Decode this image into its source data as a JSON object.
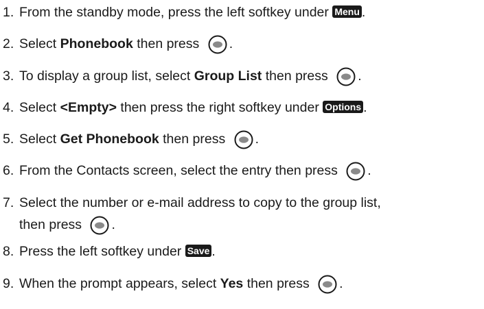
{
  "steps": [
    {
      "num": "1.",
      "parts": [
        {
          "t": "text",
          "v": "From the standby mode, press the left softkey under "
        },
        {
          "t": "softkey",
          "v": "Menu",
          "name": "menu-softkey-label"
        },
        {
          "t": "text",
          "v": "."
        }
      ]
    },
    {
      "num": "2.",
      "parts": [
        {
          "t": "text",
          "v": "Select "
        },
        {
          "t": "bold",
          "v": "Phonebook"
        },
        {
          "t": "text",
          "v": " then press "
        },
        {
          "t": "icon"
        },
        {
          "t": "text",
          "v": "."
        }
      ]
    },
    {
      "num": "3.",
      "parts": [
        {
          "t": "text",
          "v": "To display a group list, select "
        },
        {
          "t": "bold",
          "v": "Group List"
        },
        {
          "t": "text",
          "v": " then press "
        },
        {
          "t": "icon"
        },
        {
          "t": "text",
          "v": "."
        }
      ]
    },
    {
      "num": "4.",
      "parts": [
        {
          "t": "text",
          "v": "Select "
        },
        {
          "t": "bold",
          "v": "<Empty>"
        },
        {
          "t": "text",
          "v": " then press the right softkey under "
        },
        {
          "t": "softkey",
          "v": "Options",
          "name": "options-softkey-label"
        },
        {
          "t": "text",
          "v": "."
        }
      ]
    },
    {
      "num": "5.",
      "parts": [
        {
          "t": "text",
          "v": "Select "
        },
        {
          "t": "bold",
          "v": "Get Phonebook"
        },
        {
          "t": "text",
          "v": " then press "
        },
        {
          "t": "icon"
        },
        {
          "t": "text",
          "v": "."
        }
      ]
    },
    {
      "num": "6.",
      "parts": [
        {
          "t": "text",
          "v": "From the Contacts screen, select the entry then press "
        },
        {
          "t": "icon"
        },
        {
          "t": "text",
          "v": "."
        }
      ]
    },
    {
      "num": "7.",
      "parts": [
        {
          "t": "text",
          "v": "Select the number or e-mail address to copy to the group list,"
        }
      ],
      "cont": [
        {
          "t": "text",
          "v": "then press "
        },
        {
          "t": "icon"
        },
        {
          "t": "text",
          "v": "."
        }
      ]
    },
    {
      "num": "8.",
      "parts": [
        {
          "t": "text",
          "v": "Press the left softkey under "
        },
        {
          "t": "softkey",
          "v": "Save",
          "name": "save-softkey-label"
        },
        {
          "t": "text",
          "v": "."
        }
      ]
    },
    {
      "num": "9.",
      "parts": [
        {
          "t": "text",
          "v": "When the prompt appears, select "
        },
        {
          "t": "bold",
          "v": "Yes"
        },
        {
          "t": "text",
          "v": " then press "
        },
        {
          "t": "icon"
        },
        {
          "t": "text",
          "v": "."
        }
      ]
    }
  ],
  "icon_name": "center-select-key-icon"
}
